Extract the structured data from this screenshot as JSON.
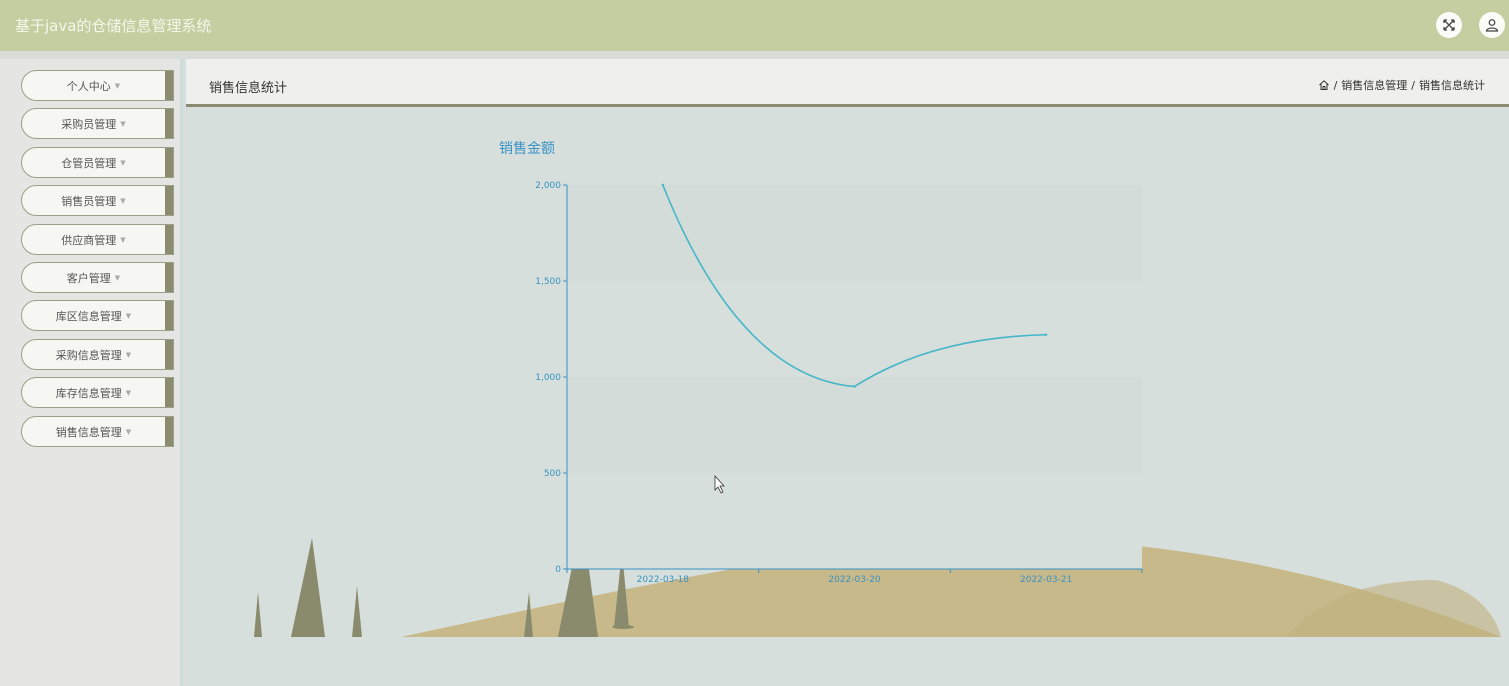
{
  "app": {
    "title": "基于java的仓储信息管理系统"
  },
  "topbar_icons": [
    "fullscreen-icon",
    "user-icon"
  ],
  "sidebar": {
    "items": [
      {
        "label": "个人中心"
      },
      {
        "label": "采购员管理"
      },
      {
        "label": "仓管员管理"
      },
      {
        "label": "销售员管理"
      },
      {
        "label": "供应商管理"
      },
      {
        "label": "客户管理"
      },
      {
        "label": "库区信息管理"
      },
      {
        "label": "采购信息管理"
      },
      {
        "label": "库存信息管理"
      },
      {
        "label": "销售信息管理"
      }
    ]
  },
  "header": {
    "page_title": "销售信息统计",
    "breadcrumb": [
      "销售信息管理",
      "销售信息统计"
    ],
    "separator": "/"
  },
  "chart_data": {
    "type": "line",
    "title": "销售金额",
    "categories": [
      "2022-03-18",
      "2022-03-20",
      "2022-03-21"
    ],
    "series": [
      {
        "values": [
          2000,
          950,
          1220
        ]
      }
    ],
    "ylim": [
      0,
      2000
    ],
    "yticks": [
      0,
      500,
      1000,
      1500,
      2000
    ],
    "ytick_labels": [
      "0",
      "500",
      "1,000",
      "1,500",
      "2,000"
    ],
    "grid": "alternating horizontal bands",
    "line_color": "#45b6c8",
    "axis_color": "#3a92c4"
  },
  "colors": {
    "topbar": "#c5cea1",
    "sidebar_accent": "#8a8b6f",
    "background": "#d6dfdb"
  }
}
